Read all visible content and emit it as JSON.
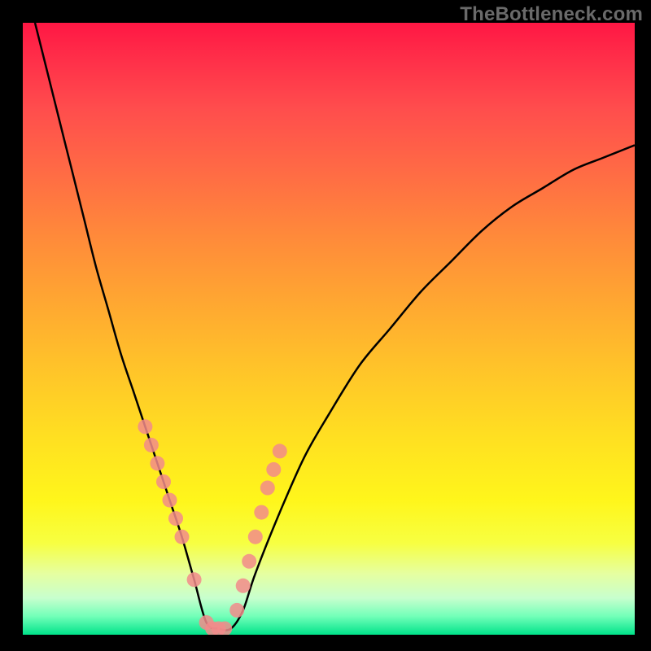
{
  "watermark": "TheBottleneck.com",
  "colors": {
    "curve": "#000000",
    "marker_fill": "#f28b8b",
    "marker_stroke": "#995050",
    "gradient_top": "#ff1744",
    "gradient_bottom": "#00e38a",
    "page_bg": "#000000"
  },
  "chart_data": {
    "type": "line",
    "title": "",
    "xlabel": "",
    "ylabel": "",
    "xlim": [
      0,
      100
    ],
    "ylim": [
      0,
      100
    ],
    "grid": false,
    "legend": false,
    "curve_comment": "Approximate V-shaped bottleneck curve; y shown as percent where 0% is bottom (green) and 100% is top (red). Minimum (bottleneck removed) is around x≈30.",
    "curve": {
      "name": "bottleneck_pct",
      "x": [
        2,
        4,
        6,
        8,
        10,
        12,
        14,
        16,
        18,
        20,
        22,
        24,
        26,
        28,
        30,
        32,
        34,
        36,
        38,
        42,
        46,
        50,
        55,
        60,
        65,
        70,
        75,
        80,
        85,
        90,
        95,
        100
      ],
      "y": [
        100,
        92,
        84,
        76,
        68,
        60,
        53,
        46,
        40,
        34,
        28,
        22,
        16,
        9,
        2,
        1,
        1,
        4,
        10,
        20,
        29,
        36,
        44,
        50,
        56,
        61,
        66,
        70,
        73,
        76,
        78,
        80
      ]
    },
    "markers_comment": "Pink scatter markers along lower portion of the V (visible data points).",
    "markers": {
      "x": [
        20,
        21,
        22,
        23,
        24,
        25,
        26,
        28,
        30,
        31,
        32,
        33,
        35,
        36,
        37,
        38,
        39,
        40,
        41,
        42
      ],
      "y": [
        34,
        31,
        28,
        25,
        22,
        19,
        16,
        9,
        2,
        1,
        1,
        1,
        4,
        8,
        12,
        16,
        20,
        24,
        27,
        30
      ]
    }
  }
}
